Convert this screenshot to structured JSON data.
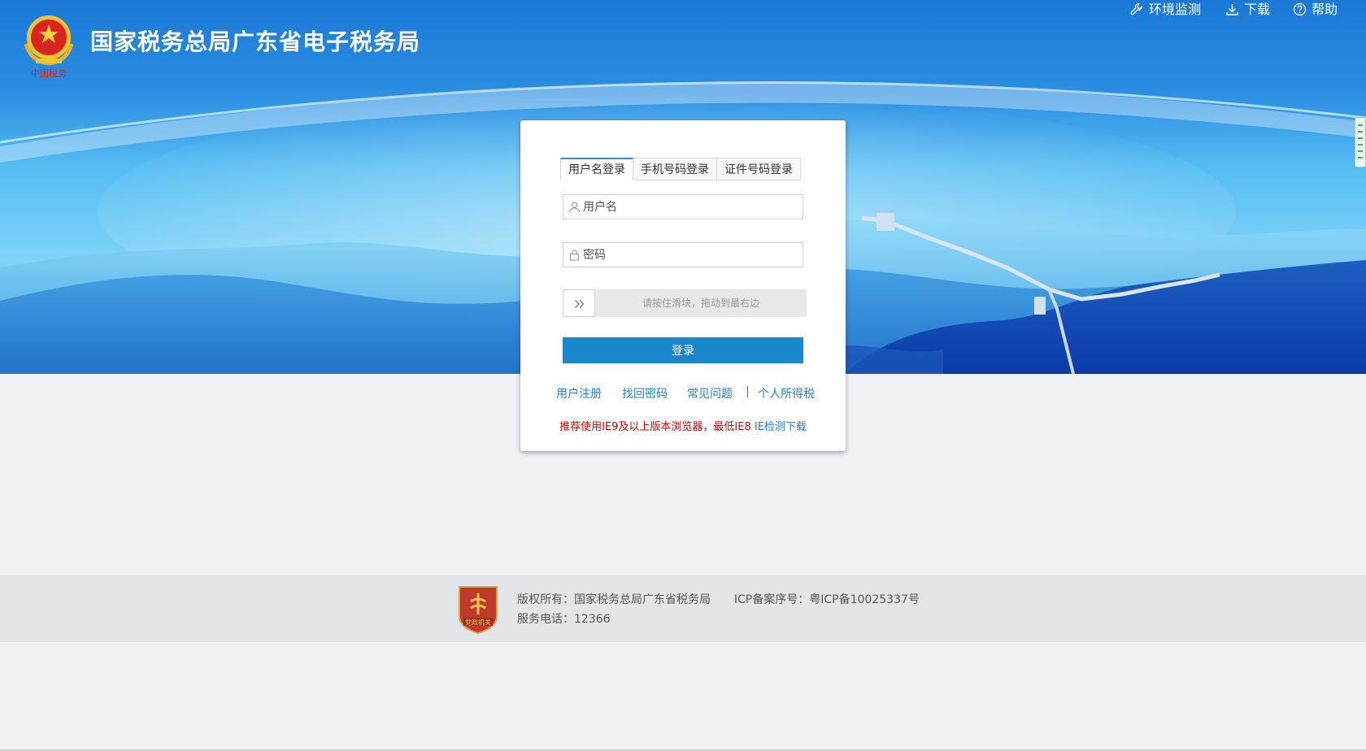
{
  "header": {
    "title": "国家税务总局广东省电子税务局",
    "logo_text": "中国税务",
    "links": [
      {
        "label": "环境监测",
        "icon": "wrench-icon"
      },
      {
        "label": "下载",
        "icon": "download-icon"
      },
      {
        "label": "帮助",
        "icon": "help-icon"
      }
    ]
  },
  "login": {
    "tabs": [
      {
        "label": "用户名登录",
        "active": true
      },
      {
        "label": "手机号码登录",
        "active": false
      },
      {
        "label": "证件号码登录",
        "active": false
      }
    ],
    "username": {
      "placeholder": "用户名",
      "value": "",
      "icon": "user-icon"
    },
    "password": {
      "placeholder": "密码",
      "value": "",
      "icon": "lock-icon"
    },
    "slider": {
      "hint": "请按住滑块，拖动到最右边",
      "icon": "double-chevron-right-icon",
      "progress": 0
    },
    "submit_label": "登录",
    "links": [
      "用户注册",
      "找回密码",
      "常见问题",
      "个人所得税"
    ],
    "separator": "|",
    "notice": {
      "warning": "推荐使用IE9及以上版本浏览器，最低IE8",
      "action": "IE检测下载"
    }
  },
  "footer": {
    "badge_text": "党政机关",
    "copyright_label": "版权所有：",
    "copyright_value": "国家税务总局广东省税务局",
    "icp_label": "ICP备案序号：",
    "icp_value": "粤ICP备10025337号",
    "phone_label": "服务电话：",
    "phone_value": "12366"
  },
  "colors": {
    "primary": "#1a86cb",
    "banner": "#1d7fd9",
    "warning": "#d40000",
    "background": "#f0f1f5",
    "footer": "#e4e5e8"
  }
}
